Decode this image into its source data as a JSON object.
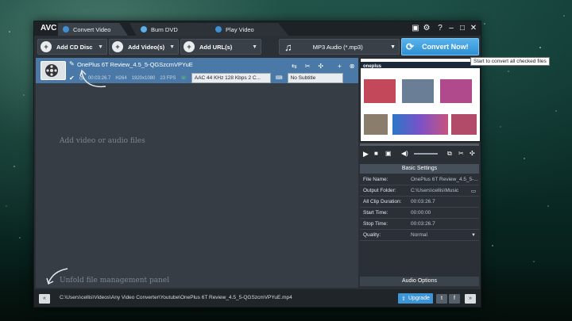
{
  "app": {
    "logo": "AVC"
  },
  "tabs": [
    {
      "label": "Convert Video"
    },
    {
      "label": "Burn DVD"
    },
    {
      "label": "Play Video"
    }
  ],
  "toolbar": {
    "add_cd": "Add CD Disc",
    "add_video": "Add Video(s)",
    "add_url": "Add URL(s)",
    "format": "MP3 Audio (*.mp3)",
    "convert": "Convert Now!"
  },
  "tooltip": "Start to convert all checked files",
  "file": {
    "title": "OnePlus 6T Review_4.5_5-QGSzcmVPYuE",
    "duration": "00:03:26.7",
    "codec": "H264",
    "resolution": "1920x1080",
    "fps": "23 FPS",
    "audio": "AAC 44 KHz 128 Kbps 2 C...",
    "subtitle": "No Subtitle"
  },
  "placeholder": "Add video or audio files",
  "unfold": "Unfold file management panel",
  "preview": {
    "site": "oneplus",
    "brand": "#1e73be"
  },
  "basic_settings": {
    "header": "Basic Settings",
    "rows": [
      {
        "k": "File Name:",
        "v": "OnePlus 6T Review_4.5_5-..."
      },
      {
        "k": "Output Folder:",
        "v": "C:\\Users\\cellis\\Music"
      },
      {
        "k": "All Clip Duration:",
        "v": "00:03:26.7"
      },
      {
        "k": "Start Time:",
        "v": "00:00:00"
      },
      {
        "k": "Stop Time:",
        "v": "00:03:26.7"
      },
      {
        "k": "Quality:",
        "v": "Normal"
      }
    ]
  },
  "audio_options": "Audio Options",
  "status": {
    "path": "C:\\Users\\cellis\\Videos\\Any Video Converter\\Youtube\\OnePlus 6T Review_4.5_5-QGSzcmVPYuE.mp4",
    "upgrade": "Upgrade"
  }
}
